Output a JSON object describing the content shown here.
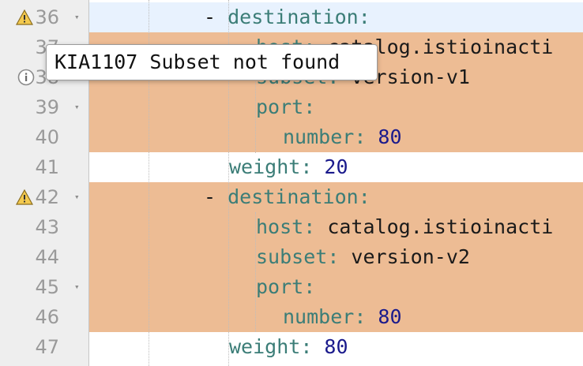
{
  "gutter": {
    "lines": [
      {
        "number": "36",
        "marker": "warning-icon",
        "fold": true
      },
      {
        "number": "37",
        "marker": "",
        "fold": false
      },
      {
        "number": "38",
        "marker": "info-icon",
        "fold": false
      },
      {
        "number": "39",
        "marker": "",
        "fold": true
      },
      {
        "number": "40",
        "marker": "",
        "fold": false
      },
      {
        "number": "41",
        "marker": "",
        "fold": false
      },
      {
        "number": "42",
        "marker": "warning-icon",
        "fold": true
      },
      {
        "number": "43",
        "marker": "",
        "fold": false
      },
      {
        "number": "44",
        "marker": "",
        "fold": false
      },
      {
        "number": "45",
        "marker": "",
        "fold": true
      },
      {
        "number": "46",
        "marker": "",
        "fold": false
      },
      {
        "number": "47",
        "marker": "",
        "fold": false
      }
    ]
  },
  "code": {
    "l36": {
      "dash": "- ",
      "key": "destination",
      "colon": ":"
    },
    "l37": {
      "key": "host",
      "colon": ":",
      "value": " catalog.istioinacti"
    },
    "l38": {
      "key": "subset",
      "colon": ":",
      "value": " version-v1"
    },
    "l39": {
      "key": "port",
      "colon": ":"
    },
    "l40": {
      "key": "number",
      "colon": ":",
      "value": " 80"
    },
    "l41": {
      "key": "weight",
      "colon": ":",
      "value": " 20"
    },
    "l42": {
      "dash": "- ",
      "key": "destination",
      "colon": ":"
    },
    "l43": {
      "key": "host",
      "colon": ":",
      "value": " catalog.istioinacti"
    },
    "l44": {
      "key": "subset",
      "colon": ":",
      "value": " version-v2"
    },
    "l45": {
      "key": "port",
      "colon": ":"
    },
    "l46": {
      "key": "number",
      "colon": ":",
      "value": " 80"
    },
    "l47": {
      "key": "weight",
      "colon": ":",
      "value": " 80"
    }
  },
  "tooltip": {
    "text": "KIA1107 Subset not found"
  },
  "colors": {
    "highlight": "#edbc94",
    "current_line": "#e8f2fe",
    "key": "#3b7d77",
    "number": "#1a1a8c"
  }
}
